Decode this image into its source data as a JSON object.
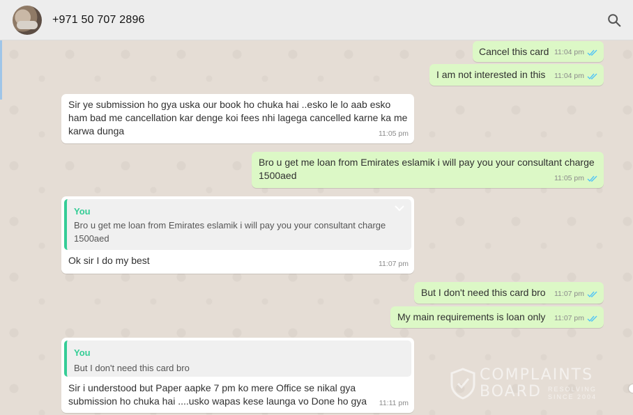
{
  "header": {
    "contact_name": "+971 50 707 2896"
  },
  "icons": {
    "search": "search-icon",
    "read_receipt": "double-check-icon",
    "menu": "chevron-down-icon"
  },
  "colors": {
    "outgoing": "#dcf8c6",
    "incoming": "#ffffff",
    "tick": "#4fc3f7",
    "quote_bar": "#35cd96"
  },
  "messages": [
    {
      "direction": "out",
      "text": "Cancel this card",
      "time": "11:04 pm"
    },
    {
      "direction": "out",
      "text": "I am not interested in this",
      "time": "11:04 pm"
    },
    {
      "direction": "in",
      "lines": [
        "Sir ye submission ho gya uska our book ho chuka hai ..esko le lo aab esko",
        "ham bad me cancellation kar denge koi fees nhi lagega cancelled karne ka me",
        "karwa dunga"
      ],
      "time": "11:05 pm"
    },
    {
      "direction": "out",
      "lines": [
        "Bro u get me loan from Emirates eslamik i will pay you your consultant charge",
        "1500aed"
      ],
      "time": "11:05 pm"
    },
    {
      "direction": "in",
      "quote": {
        "author": "You",
        "lines": [
          "Bro u get me loan from Emirates eslamik i will pay you your consultant charge",
          "1500aed"
        ]
      },
      "text": "Ok sir I do my best",
      "time": "11:07 pm"
    },
    {
      "direction": "out",
      "text": "But I don't need this card bro",
      "time": "11:07 pm"
    },
    {
      "direction": "out",
      "text": "My main requirements is loan only",
      "time": "11:07 pm"
    },
    {
      "direction": "in",
      "quote": {
        "author": "You",
        "text": "But I don't need this card bro"
      },
      "lines": [
        "Sir i understood  but Paper aapke 7 pm ko mere Office se nikal gya",
        "submission ho chuka hai ....usko wapas kese launga vo Done ho gya"
      ],
      "time": "11:11 pm"
    }
  ],
  "watermark": {
    "line1": "COMPLAINTS",
    "line2": "BOARD",
    "tag1": "RESOLVING",
    "tag2": "SINCE 2004"
  }
}
